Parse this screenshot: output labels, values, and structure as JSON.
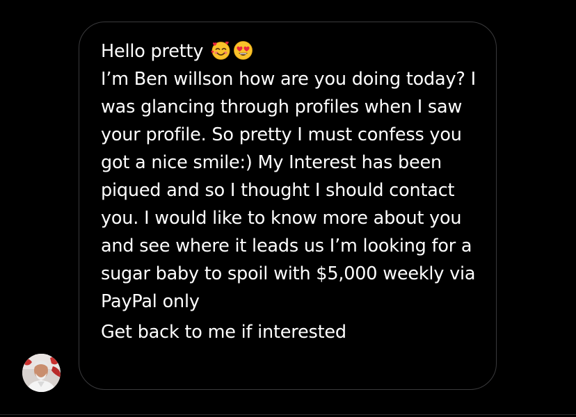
{
  "message": {
    "greeting": "Hello pretty",
    "greeting_emojis": [
      "smiling-face-with-hearts-icon",
      "heart-eyes-icon"
    ],
    "body": "I’m Ben willson how are you doing today? I was glancing through profiles when I saw your profile. So pretty I must confess you got a nice smile:) My Interest has been piqued and so I thought I should contact you. I would like to know more about you and see where it leads us I’m looking for a sugar baby to spoil with $5,000 weekly via PayPal only",
    "closing": "Get back to me if interested"
  },
  "sender": {
    "avatar_icon": "sender-avatar"
  },
  "colors": {
    "background": "#000000",
    "bubble_border": "#3a3a3c",
    "text": "#ffffff"
  }
}
